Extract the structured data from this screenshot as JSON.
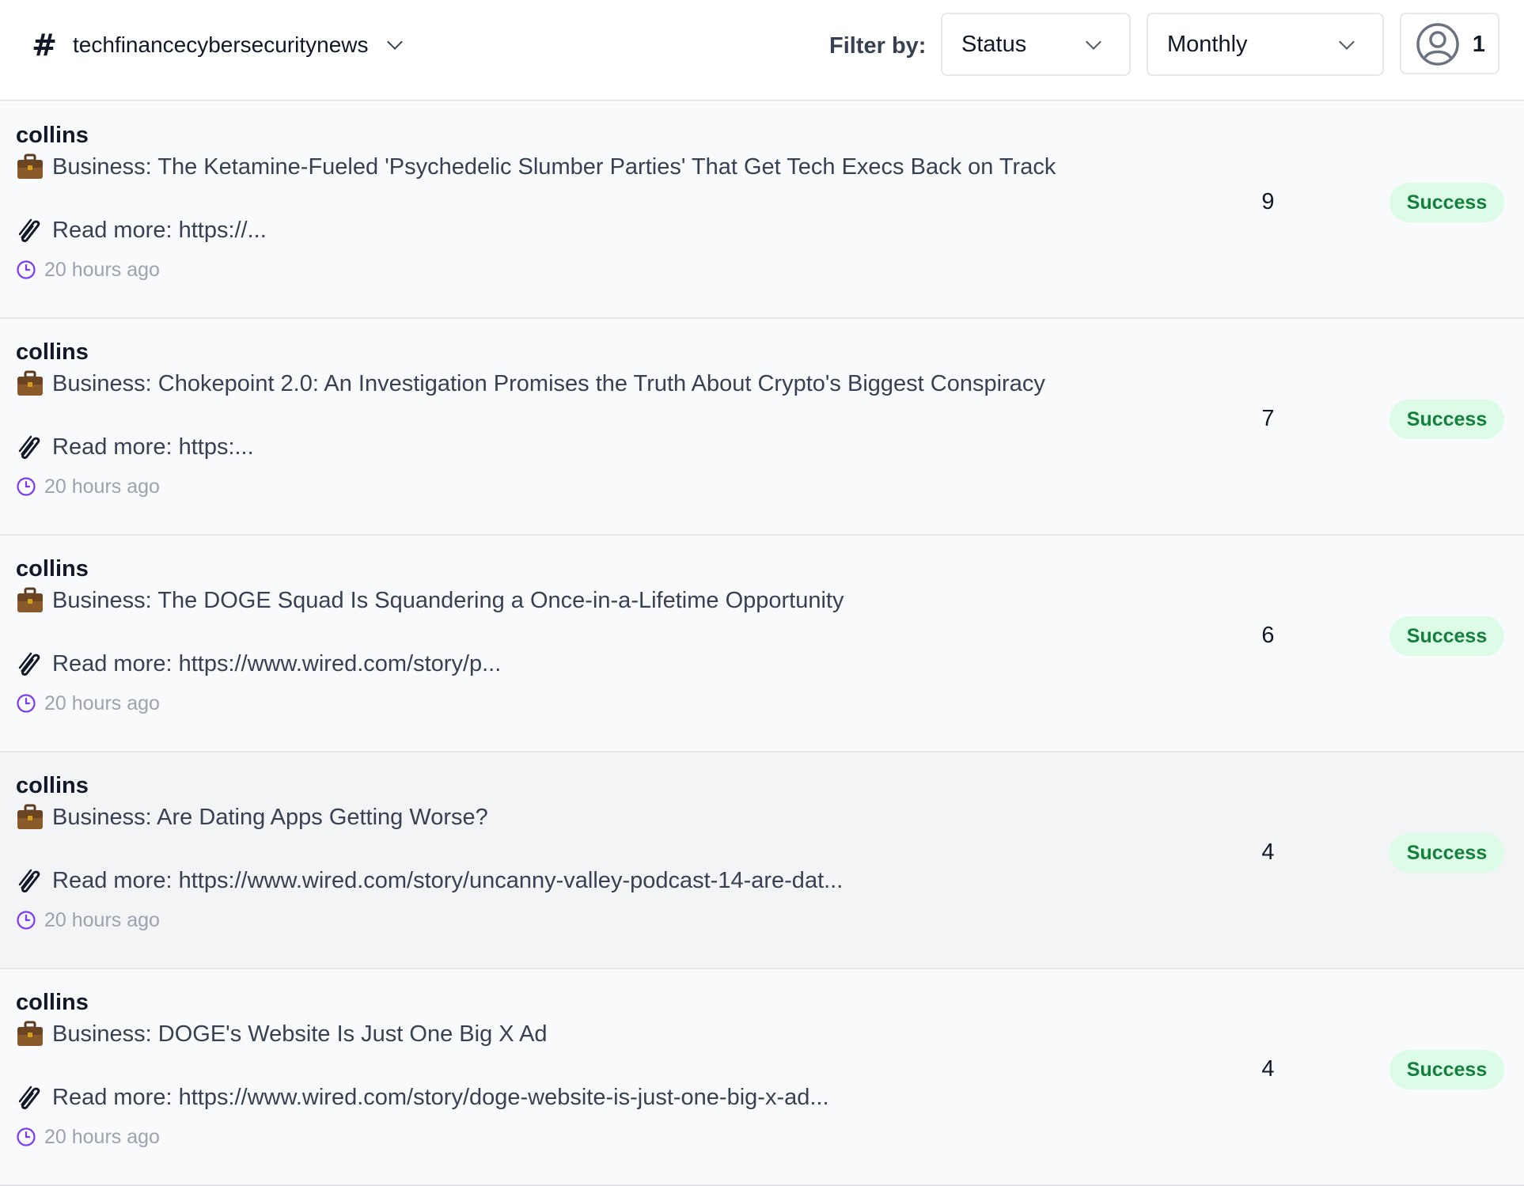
{
  "header": {
    "channel_icon": "hash-icon",
    "channel_name": "techfinancecybersecuritynews",
    "filter_label": "Filter by:",
    "status_filter": {
      "value": "Status"
    },
    "period_filter": {
      "value": "Monthly"
    },
    "user_count": "1"
  },
  "colors": {
    "row_bg": "#f9fafb",
    "row_hover_bg": "#f3f4f6",
    "badge_bg": "#dcfce7",
    "badge_text": "#15803d",
    "clock_icon": "#7c3aed"
  },
  "posts": [
    {
      "author": "collins",
      "title": "Business: The Ketamine-Fueled 'Psychedelic Slumber Parties' That Get Tech Execs Back on Track",
      "link": "Read more: https://...",
      "time": "20 hours ago",
      "count": "9",
      "status": "Success"
    },
    {
      "author": "collins",
      "title": "Business: Chokepoint 2.0: An Investigation Promises the Truth About Crypto's Biggest Conspiracy",
      "link": "Read more: https:...",
      "time": "20 hours ago",
      "count": "7",
      "status": "Success"
    },
    {
      "author": "collins",
      "title": "Business: The DOGE Squad Is Squandering a Once-in-a-Lifetime Opportunity",
      "link": "Read more: https://www.wired.com/story/p...",
      "time": "20 hours ago",
      "count": "6",
      "status": "Success"
    },
    {
      "author": "collins",
      "title": "Business: Are Dating Apps Getting Worse?",
      "link": "Read more: https://www.wired.com/story/uncanny-valley-podcast-14-are-dat...",
      "time": "20 hours ago",
      "count": "4",
      "status": "Success"
    },
    {
      "author": "collins",
      "title": "Business: DOGE's Website Is Just One Big X Ad",
      "link": "Read more: https://www.wired.com/story/doge-website-is-just-one-big-x-ad...",
      "time": "20 hours ago",
      "count": "4",
      "status": "Success"
    }
  ]
}
